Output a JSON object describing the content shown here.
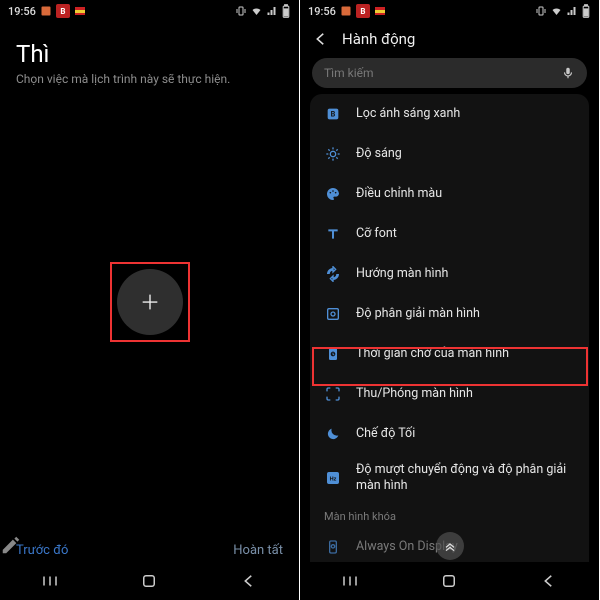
{
  "statusbar": {
    "time": "19:56",
    "icon1_letter": "B"
  },
  "left": {
    "title": "Thì",
    "subtitle": "Chọn việc mà lịch trình này sẽ thực hiện.",
    "prev": "Trước đó",
    "done": "Hoàn tất"
  },
  "right": {
    "header_title": "Hành động",
    "search_placeholder": "Tìm kiếm",
    "section_lock": "Màn hình khóa",
    "items": [
      {
        "label": "Lọc ánh sáng xanh"
      },
      {
        "label": "Độ sáng"
      },
      {
        "label": "Điều chỉnh màu"
      },
      {
        "label": "Cỡ font"
      },
      {
        "label": "Hướng màn hình"
      },
      {
        "label": "Độ phân giải màn hình"
      },
      {
        "label": "Thời gian chờ của màn hình"
      },
      {
        "label": "Thu/Phóng màn hình"
      },
      {
        "label": "Chế độ Tối"
      },
      {
        "label": "Độ mượt chuyển động và độ phân giải màn hình"
      },
      {
        "label": "Always On Display"
      }
    ]
  }
}
